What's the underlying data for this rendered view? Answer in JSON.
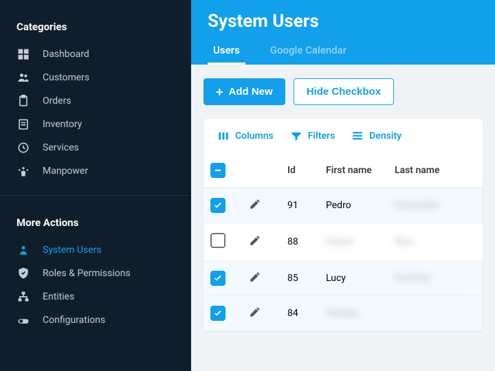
{
  "sidebar": {
    "categories_title": "Categories",
    "more_actions_title": "More Actions",
    "categories": [
      {
        "label": "Dashboard",
        "icon": "dashboard"
      },
      {
        "label": "Customers",
        "icon": "customers"
      },
      {
        "label": "Orders",
        "icon": "orders"
      },
      {
        "label": "Inventory",
        "icon": "inventory"
      },
      {
        "label": "Services",
        "icon": "services"
      },
      {
        "label": "Manpower",
        "icon": "manpower"
      }
    ],
    "more_actions": [
      {
        "label": "System Users",
        "icon": "system-users",
        "active": true
      },
      {
        "label": "Roles & Permissions",
        "icon": "roles"
      },
      {
        "label": "Entities",
        "icon": "entities"
      },
      {
        "label": "Configurations",
        "icon": "configurations"
      }
    ]
  },
  "header": {
    "title": "System Users",
    "tabs": [
      {
        "label": "Users",
        "active": true
      },
      {
        "label": "Google Calendar",
        "active": false
      }
    ]
  },
  "toolbar": {
    "add_new_label": "Add New",
    "hide_checkbox_label": "Hide Checkbox"
  },
  "grid_toolbar": {
    "columns_label": "Columns",
    "filters_label": "Filters",
    "density_label": "Density"
  },
  "columns": {
    "id_header": "Id",
    "first_name_header": "First name",
    "last_name_header": "Last name"
  },
  "rows": [
    {
      "id": "91",
      "first_name": "Pedro",
      "last_name": "Fernandes",
      "checked": true,
      "ln_blur": true
    },
    {
      "id": "88",
      "first_name": "Gracie",
      "last_name": "Rice",
      "checked": false,
      "fn_blur": true,
      "ln_blur": true
    },
    {
      "id": "85",
      "first_name": "Lucy",
      "last_name": "Oconnor",
      "checked": true,
      "ln_blur": true
    },
    {
      "id": "84",
      "first_name": "Tamara",
      "last_name": "",
      "checked": true,
      "fn_blur": true
    }
  ],
  "colors": {
    "accent": "#129fec",
    "sidebar_bg": "#101e2c"
  }
}
